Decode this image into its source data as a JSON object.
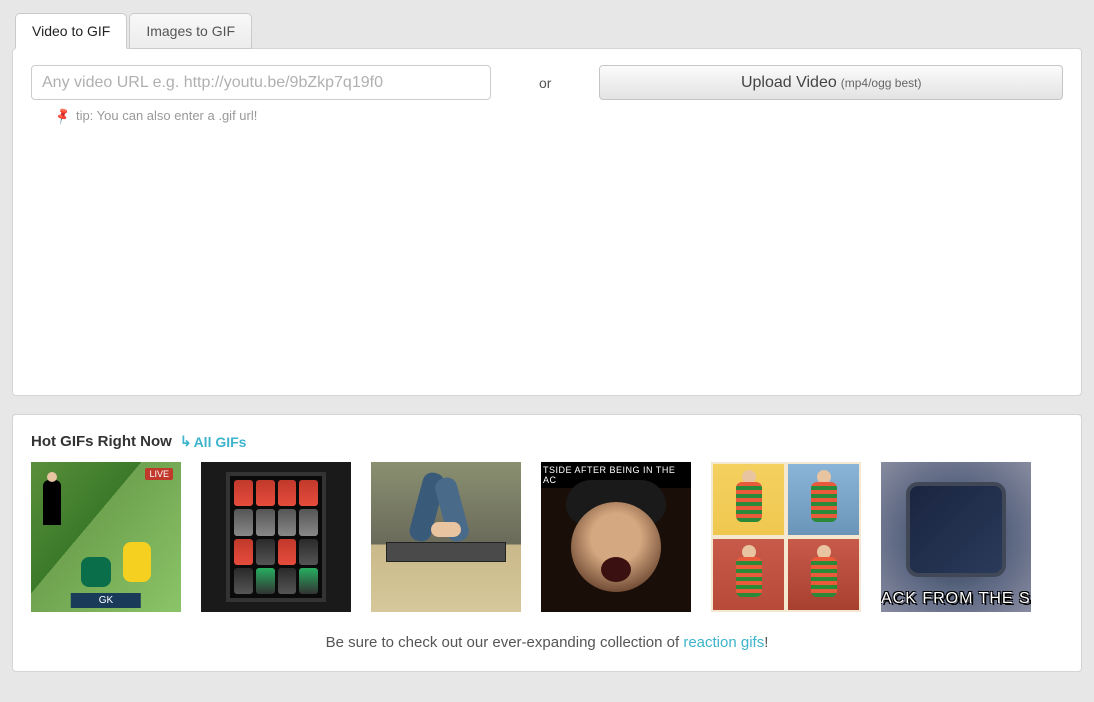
{
  "tabs": {
    "video": "Video to GIF",
    "images": "Images to GIF"
  },
  "url_placeholder": "Any video URL e.g. http://youtu.be/9bZkp7q19f0",
  "separator": "or",
  "upload": {
    "label": "Upload Video",
    "hint": "(mp4/ogg best)"
  },
  "tip": "tip: You can also enter a .gif url!",
  "hot": {
    "title": "Hot GIFs Right Now",
    "all_link": "All GIFs"
  },
  "thumbs": {
    "t4_banner": "TSIDE AFTER BEING IN THE AC",
    "t6_caption": "ACK FROM THE SAT"
  },
  "footer": {
    "prefix": "Be sure to check out our ever-expanding collection of ",
    "link": "reaction gifs",
    "suffix": "!"
  }
}
